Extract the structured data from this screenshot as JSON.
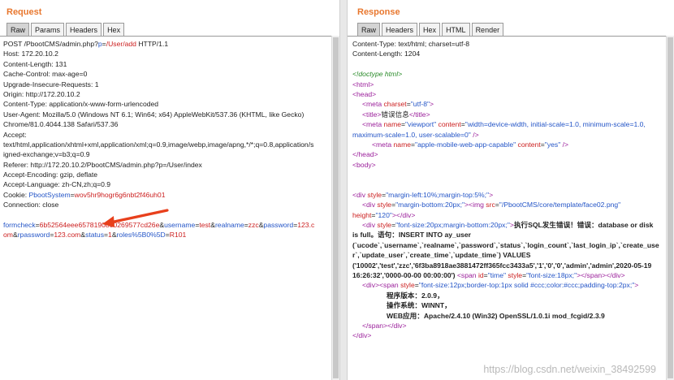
{
  "request": {
    "title": "Request",
    "tabs": [
      "Raw",
      "Params",
      "Headers",
      "Hex"
    ],
    "active_tab": "Raw",
    "lines": {
      "l1a": "POST /PbootCMS/admin.php?",
      "l1b": "p",
      "l1c": "=",
      "l1d": "/User/add",
      "l1e": " HTTP/1.1",
      "l2": "Host: 172.20.10.2",
      "l3": "Content-Length: 131",
      "l4": "Cache-Control: max-age=0",
      "l5": "Upgrade-Insecure-Requests: 1",
      "l6": "Origin: http://172.20.10.2",
      "l7": "Content-Type: application/x-www-form-urlencoded",
      "l8": "User-Agent: Mozilla/5.0 (Windows NT 6.1; Win64; x64) AppleWebKit/537.36 (KHTML, like Gecko)",
      "l9": "Chrome/81.0.4044.138 Safari/537.36",
      "l10": "Accept:",
      "l11": "text/html,application/xhtml+xml,application/xml;q=0.9,image/webp,image/apng,*/*;q=0.8,application/s",
      "l12": "igned-exchange;v=b3;q=0.9",
      "l13": "Referer: http://172.20.10.2/PbootCMS/admin.php?p=/User/index",
      "l14": "Accept-Encoding: gzip, deflate",
      "l15": "Accept-Language: zh-CN,zh;q=0.9",
      "l16a": "Cookie: ",
      "l16b": "PbootSystem",
      "l16c": "=",
      "l16d": "wov5hr9hogr6g6nbt2f46uh01",
      "l17": "Connection: close",
      "b1": "formcheck",
      "b2": "=",
      "b3": "6b52564eee6578190800269577cd26e",
      "b4": "&",
      "b5": "username",
      "b6": "=",
      "b7": "test",
      "b8": "&",
      "b9": "realname",
      "b10": "=",
      "b11": "zzc",
      "b12": "&",
      "b13": "password",
      "b14": "=",
      "b15": "123.c",
      "c1": "om",
      "c2": "&",
      "c3": "rpassword",
      "c4": "=",
      "c5": "123.com",
      "c6": "&",
      "c7": "status",
      "c8": "=",
      "c9": "1",
      "c10": "&",
      "c11": "roles%5B0%5D",
      "c12": "=",
      "c13": "R101"
    }
  },
  "response": {
    "title": "Response",
    "tabs": [
      "Raw",
      "Headers",
      "Hex",
      "HTML",
      "Render"
    ],
    "active_tab": "Raw",
    "lines": {
      "r1": "Content-Type: text/html; charset=utf-8",
      "r2": "Content-Length: 1204",
      "r3": "<!doctype html>",
      "r4": "<html>",
      "r5": "<head>",
      "r6a": "<meta",
      "r6b": " charset",
      "r6c": "=",
      "r6d": "\"utf-8\"",
      "r6e": ">",
      "r7a": "<title>",
      "r7b": "错误信息",
      "r7c": "</title>",
      "r8a": "<meta",
      "r8b": " name",
      "r8c": "=",
      "r8d": "\"viewport\"",
      "r8e": " content",
      "r8f": "=",
      "r8g": "\"width=device-width, initial-scale=1.0, minimum-scale=1.0,",
      "r9a": "maximum-scale=1.0, user-scalable=0\"",
      "r9b": " />",
      "r10a": "<meta",
      "r10b": " name",
      "r10c": "=",
      "r10d": "\"apple-mobile-web-app-capable\"",
      "r10e": " content",
      "r10f": "=",
      "r10g": "\"yes\"",
      "r10h": " />",
      "r11": "</head>",
      "r12": "<body>",
      "r13a": "<div",
      "r13b": " style",
      "r13c": "=",
      "r13d": "\"margin-left:10%;margin-top:5%;\"",
      "r13e": ">",
      "r14a": "<div",
      "r14b": " style",
      "r14c": "=",
      "r14d": "\"margin-bottom:20px;\"",
      "r14e": "><img",
      "r14f": " src",
      "r14g": "=",
      "r14h": "\"/PbootCMS/core/template/face02.png\"",
      "r15a": "height",
      "r15b": "=",
      "r15c": "\"120\"",
      "r15d": "></div>",
      "r16a": "<div",
      "r16b": " style",
      "r16c": "=",
      "r16d": "\"font-size:20px;margin-bottom:20px;\"",
      "r16e": ">",
      "r16f": "执行SQL发生错误！错误：database or disk",
      "r17": "is full。语句：INSERT INTO ay_user",
      "r18": "(`ucode`,`username`,`realname`,`password`,`status`,`login_count`,`last_login_ip`,`create_use",
      "r19": "r`,`update_user`,`create_time`,`update_time`) VALUES",
      "r20": "('10002','test','zzc','6f3ba8918ae3881472ff365fcc3433a5','1','0','0','admin','admin',2020-05-19",
      "r21a": "16:26:32','0000-00-00 00:00:00')",
      "r21b": " <span",
      "r21c": " id",
      "r21d": "=",
      "r21e": "\"time\"",
      "r21f": " style",
      "r21g": "=",
      "r21h": "\"font-size:18px;\"",
      "r21i": "></span></div>",
      "r22a": "<div><span",
      "r22b": " style",
      "r22c": "=",
      "r22d": "\"font-size:12px;border-top:1px solid #ccc;color:#ccc;padding-top:2px;\"",
      "r22e": ">",
      "r23": "程序版本：2.0.9，",
      "r24": "操作系统：WINNT，",
      "r25": "WEB应用：Apache/2.4.10 (Win32) OpenSSL/1.0.1i mod_fcgid/2.3.9",
      "r26": "</span></div>",
      "r27": "</div>"
    }
  },
  "watermark": "https://blog.csdn.net/weixin_38492599",
  "colors": {
    "title": "#e8772e",
    "param_key": "#2455c7",
    "param_value": "#cc2020",
    "tag": "#9b1f9b",
    "arrow": "#e8401c"
  }
}
